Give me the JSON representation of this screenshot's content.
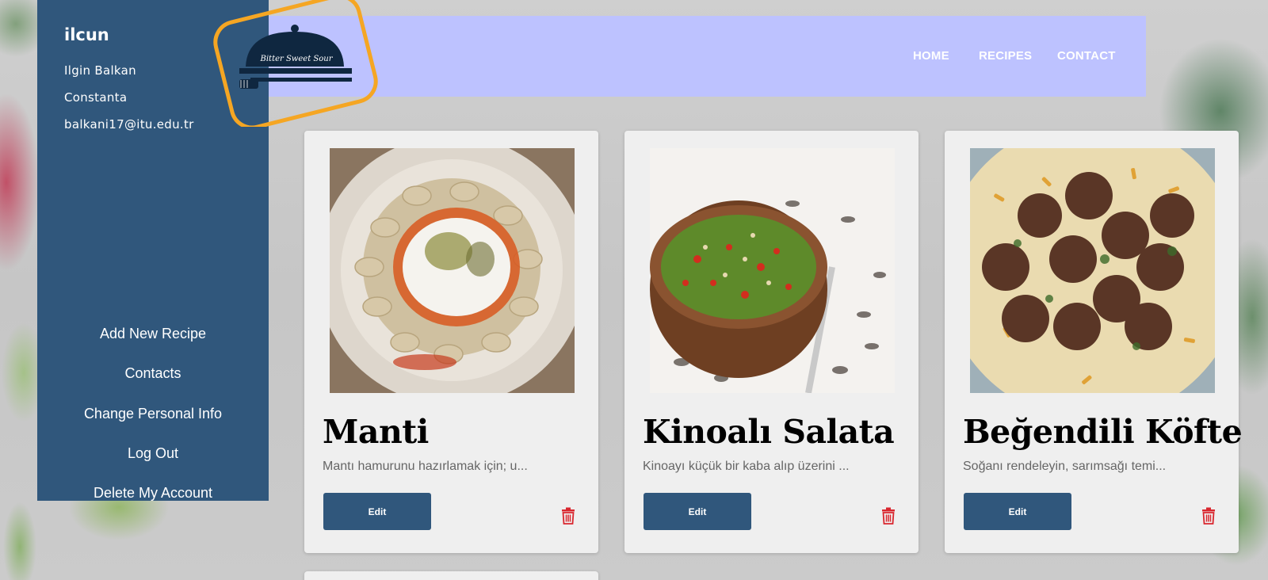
{
  "sidebar": {
    "username": "ilcun",
    "full_name": "Ilgin Balkan",
    "city": "Constanta",
    "email": "balkani17@itu.edu.tr",
    "menu": [
      "Add New Recipe",
      "Contacts",
      "Change Personal Info",
      "Log Out",
      "Delete My Account"
    ]
  },
  "logo": {
    "text": "Bitter Sweet Sour"
  },
  "nav": {
    "home": "HOME",
    "recipes": "RECIPES",
    "contact": "CONTACT"
  },
  "recipes": [
    {
      "title": "Manti",
      "description": "Mantı hamurunu hazırlamak için; u...",
      "edit_label": "Edit",
      "image": "manti-photo"
    },
    {
      "title": "Kinoalı Salata",
      "description": "Kinoayı küçük bir kaba alıp üzerini ...",
      "edit_label": "Edit",
      "image": "quinoa-salad-photo"
    },
    {
      "title": "Beğendili Köfte",
      "description": "Soğanı rendeleyin, sarımsağı temi...",
      "edit_label": "Edit",
      "image": "meatballs-photo"
    }
  ],
  "colors": {
    "sidebar": "#30577c",
    "navbar": "#bdc2ff",
    "button": "#30577c",
    "delete": "#d9262e",
    "logo_ring": "#f5a623"
  }
}
